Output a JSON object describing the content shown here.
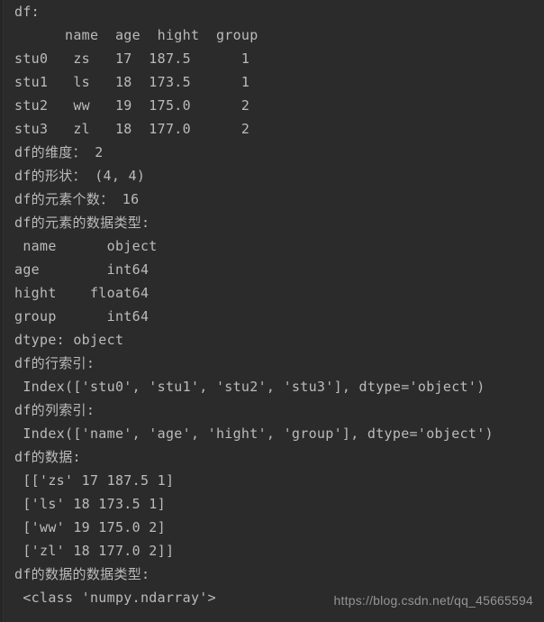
{
  "window": {
    "background_color": "#2b2b2b",
    "text_color": "#bbbbbb",
    "title": "Python console output"
  },
  "watermark": {
    "text": "https://blog.csdn.net/qq_45665594",
    "color": "#9a9a9a"
  },
  "console": {
    "lines": [
      "df:",
      "      name  age  hight  group",
      "stu0   zs   17  187.5      1",
      "stu1   ls   18  173.5      1",
      "stu2   ww   19  175.0      2",
      "stu3   zl   18  177.0      2",
      "df的维度： 2",
      "df的形状： (4, 4)",
      "df的元素个数： 16",
      "df的元素的数据类型:",
      " name      object",
      "age        int64",
      "hight    float64",
      "group      int64",
      "dtype: object",
      "df的行索引:",
      " Index(['stu0', 'stu1', 'stu2', 'stu3'], dtype='object')",
      "df的列索引:",
      " Index(['name', 'age', 'hight', 'group'], dtype='object')",
      "df的数据:",
      " [['zs' 17 187.5 1]",
      " ['ls' 18 173.5 1]",
      " ['ww' 19 175.0 2]",
      " ['zl' 18 177.0 2]]",
      "df的数据的数据类型:",
      " <class 'numpy.ndarray'>"
    ]
  },
  "chart_data": {
    "type": "table",
    "title": "df",
    "index_name": "",
    "columns": [
      "name",
      "age",
      "hight",
      "group"
    ],
    "index": [
      "stu0",
      "stu1",
      "stu2",
      "stu3"
    ],
    "rows": [
      [
        "zs",
        17,
        187.5,
        1
      ],
      [
        "ls",
        18,
        173.5,
        1
      ],
      [
        "ww",
        19,
        175.0,
        2
      ],
      [
        "zl",
        18,
        177.0,
        2
      ]
    ],
    "ndim": 2,
    "shape": [
      4,
      4
    ],
    "size": 16,
    "dtypes": [
      {
        "column": "name",
        "dtype": "object"
      },
      {
        "column": "age",
        "dtype": "int64"
      },
      {
        "column": "hight",
        "dtype": "float64"
      },
      {
        "column": "group",
        "dtype": "int64"
      }
    ],
    "dtypes_series_dtype": "object",
    "values_type": "<class 'numpy.ndarray'>"
  }
}
